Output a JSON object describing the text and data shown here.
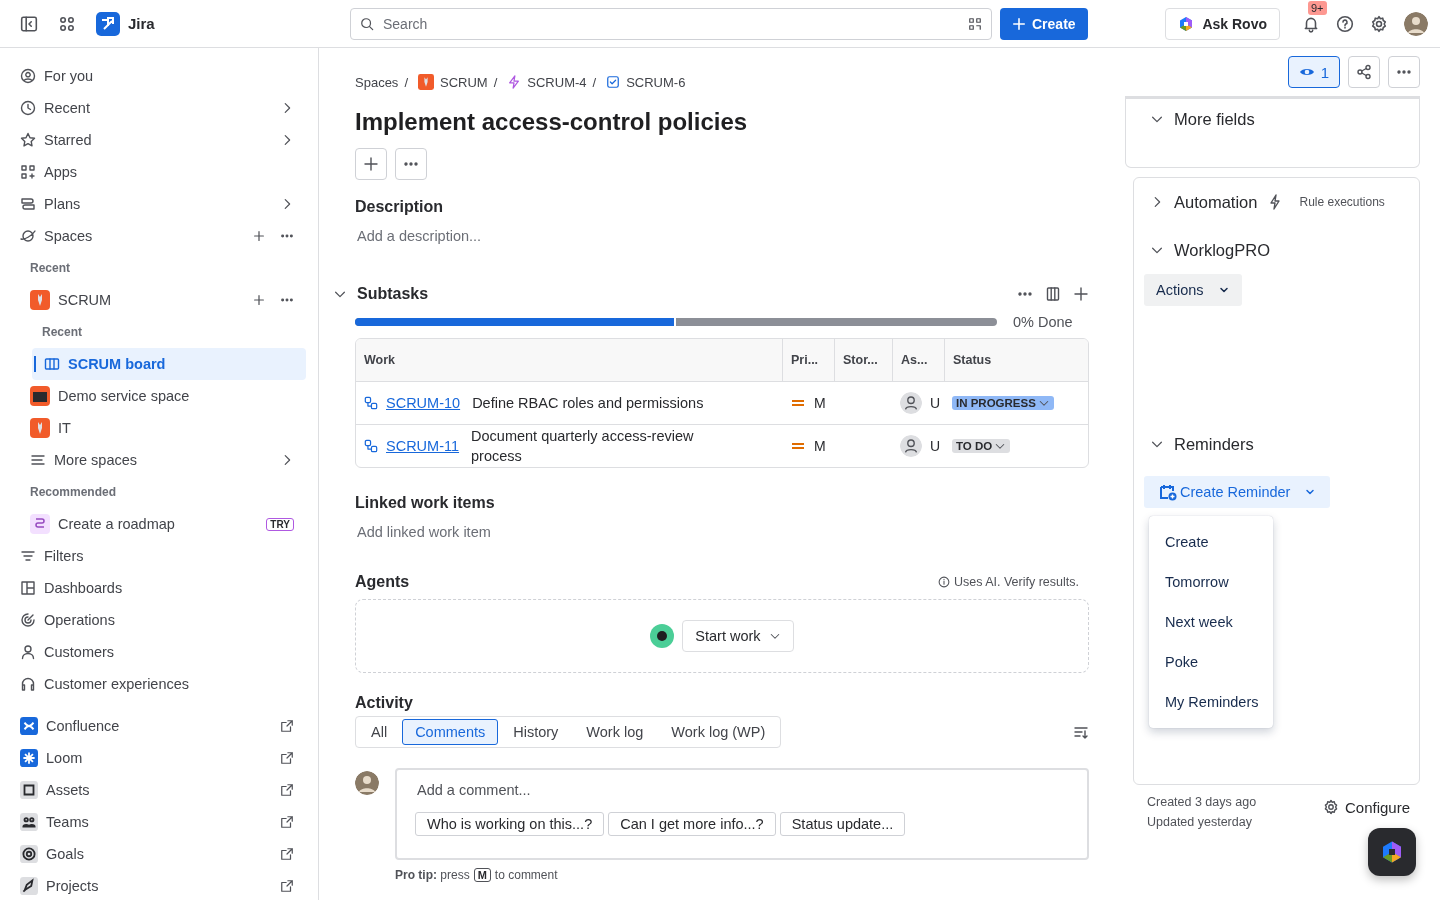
{
  "topbar": {
    "product": "Jira",
    "search": {
      "placeholder": "Search"
    },
    "create": "Create",
    "ask": "Ask Rovo",
    "notifications": "9+"
  },
  "sidebar": {
    "items": [
      {
        "kind": "nav",
        "label": "For you",
        "chevron": false,
        "actions": false,
        "selected": false
      },
      {
        "kind": "nav",
        "label": "Recent",
        "chevron": true,
        "actions": false,
        "selected": false
      },
      {
        "kind": "nav",
        "label": "Starred",
        "chevron": true,
        "actions": false,
        "selected": false
      },
      {
        "kind": "nav",
        "label": "Apps",
        "chevron": false,
        "actions": false,
        "selected": false
      },
      {
        "kind": "nav",
        "label": "Plans",
        "chevron": true,
        "actions": false,
        "selected": false
      },
      {
        "kind": "nav",
        "label": "Spaces",
        "chevron": false,
        "actions": true,
        "selected": false
      },
      {
        "kind": "heading",
        "label": "Recent"
      },
      {
        "kind": "space",
        "label": "SCRUM",
        "chevron": false,
        "actions": true,
        "selected": false
      },
      {
        "kind": "subheading",
        "label": "Recent"
      },
      {
        "kind": "board",
        "label": "SCRUM board",
        "selected": true
      },
      {
        "kind": "space",
        "label": "Demo service space",
        "chevron": false,
        "actions": false,
        "selected": false
      },
      {
        "kind": "space",
        "label": "IT",
        "chevron": false,
        "actions": false,
        "selected": false
      },
      {
        "kind": "more",
        "label": "More spaces",
        "chevron": true,
        "actions": false,
        "selected": false
      },
      {
        "kind": "heading",
        "label": "Recommended"
      },
      {
        "kind": "promo",
        "label": "Create a roadmap",
        "tag": "TRY",
        "selected": false
      },
      {
        "kind": "nav",
        "label": "Filters",
        "chevron": false,
        "actions": false,
        "selected": false
      },
      {
        "kind": "nav",
        "label": "Dashboards",
        "chevron": false,
        "actions": false,
        "selected": false
      },
      {
        "kind": "nav",
        "label": "Operations",
        "chevron": false,
        "actions": false,
        "selected": false
      },
      {
        "kind": "nav",
        "label": "Customers",
        "chevron": false,
        "actions": false,
        "selected": false
      },
      {
        "kind": "nav",
        "label": "Customer experiences",
        "chevron": false,
        "actions": false,
        "selected": false
      },
      {
        "kind": "app",
        "label": "Confluence",
        "color": "#1868db",
        "selected": false
      },
      {
        "kind": "app",
        "label": "Loom",
        "color": "#1868db",
        "selected": false
      },
      {
        "kind": "app",
        "label": "Assets",
        "color": "#dddee1",
        "selected": false
      },
      {
        "kind": "app",
        "label": "Teams",
        "color": "#dddee1",
        "selected": false
      },
      {
        "kind": "app",
        "label": "Goals",
        "color": "#dddee1",
        "selected": false
      },
      {
        "kind": "app",
        "label": "Projects",
        "color": "#dddee1",
        "selected": false
      }
    ]
  },
  "breadcrumbs": [
    {
      "label": "Spaces",
      "separator": "/"
    },
    {
      "label": "SCRUM",
      "separator": "/"
    },
    {
      "label": "SCRUM-4",
      "separator": "/"
    },
    {
      "label": "SCRUM-6"
    }
  ],
  "title": "Implement access-control policies",
  "description": {
    "heading": "Description",
    "placeholder": "Add a description..."
  },
  "subtasks": {
    "heading": "Subtasks",
    "expanded": true,
    "progress": {
      "level": 0.5,
      "reading": "0% Done"
    },
    "columns": [
      "Work",
      "Pri...",
      "Stor...",
      "As...",
      "Status"
    ],
    "rows": [
      {
        "key": "SCRUM-10",
        "summary": "Define RBAC roles and permissions",
        "priority": "M",
        "assignee": "U",
        "status": {
          "label": "IN PROGRESS",
          "kind": "inprogress"
        }
      },
      {
        "key": "SCRUM-11",
        "summary": "Document quarterly access-review process",
        "priority": "M",
        "assignee": "U",
        "status": {
          "label": "TO DO",
          "kind": "todo"
        }
      }
    ]
  },
  "linked": {
    "heading": "Linked work items",
    "action": "Add linked work item"
  },
  "agents": {
    "heading": "Agents",
    "note": "Uses AI. Verify results.",
    "button": "Start work"
  },
  "activity": {
    "heading": "Activity",
    "tabs": [
      {
        "label": "All",
        "selected": false
      },
      {
        "label": "Comments",
        "selected": true
      },
      {
        "label": "History",
        "selected": false
      },
      {
        "label": "Work log",
        "selected": false
      },
      {
        "label": "Work log (WP)",
        "selected": false
      }
    ],
    "comment": {
      "placeholder": "Add a comment..."
    },
    "suggestions": [
      "Who is working on this...?",
      "Can I get more info...?",
      "Status update..."
    ],
    "tip_start": "**Pro tip:** press",
    "tip_key": "M",
    "tip_end": "to comment"
  },
  "side": {
    "watchers": "1",
    "more_fields": {
      "heading": "More fields",
      "expanded": true
    },
    "automation": {
      "heading": "Automation",
      "expanded": false,
      "link": "Rule executions"
    },
    "worklog": {
      "heading": "WorklogPRO",
      "expanded": true,
      "button": "Actions"
    },
    "reminders": {
      "heading": "Reminders",
      "expanded": true,
      "button": "Create Reminder",
      "menu": [
        "Create",
        "Tomorrow",
        "Next week",
        "Poke",
        "My Reminders"
      ]
    },
    "created": "Created 3 days ago",
    "updated": "Updated yesterday",
    "configure": "Configure"
  }
}
